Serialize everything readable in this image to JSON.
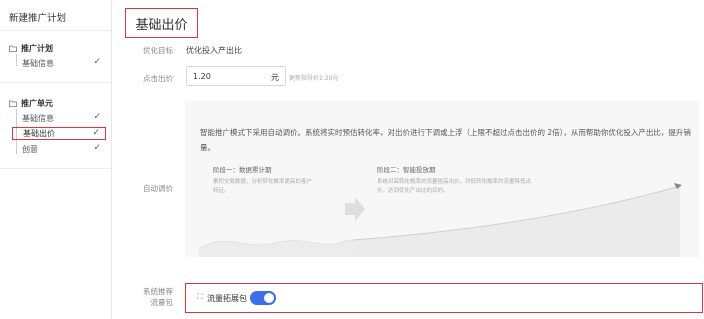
{
  "sidebar": {
    "title": "新建推广计划",
    "plan_group": {
      "label": "推广计划",
      "items": [
        {
          "label": "基础信息",
          "check": "✓"
        }
      ]
    },
    "unit_group": {
      "label": "推广单元",
      "items": [
        {
          "label": "基础信息",
          "check": "✓"
        },
        {
          "label": "基础出价",
          "check": "✓"
        },
        {
          "label": "创意",
          "check": "✓"
        }
      ]
    }
  },
  "main": {
    "title": "基础出价",
    "optimize_goal": {
      "label": "优化目标",
      "value": "优化投入产出比"
    },
    "click_bid": {
      "label": "点击出价",
      "value": "1.20",
      "unit": "元",
      "hint": "更新指导价1.20元"
    },
    "auto_adjust": {
      "label": "自动调价",
      "description": "智能推广模式下采用自动调价。系统将实时预估转化率，对出价进行下调或上浮（上限不超过点击出价的 2倍），从而帮助你优化投入产出比，提升销量。",
      "stage1": {
        "title": "阶段一：数据累计期",
        "desc": "累积交易数据，分析转化概率更高的客户特征。"
      },
      "stage2": {
        "title": "阶段二：智能投放期",
        "desc": "系统对高转化概率的流量提高出价，对低转化概率的流量降低出价，达到优化产出比的目的。"
      }
    },
    "traffic": {
      "label_line1": "系统推荐",
      "label_line2": "流量包",
      "icon": "expand-icon",
      "item_label": "流量拓展包",
      "toggle_on": true
    }
  },
  "colors": {
    "highlight": "#d9363e",
    "toggle": "#3c6ee8"
  }
}
